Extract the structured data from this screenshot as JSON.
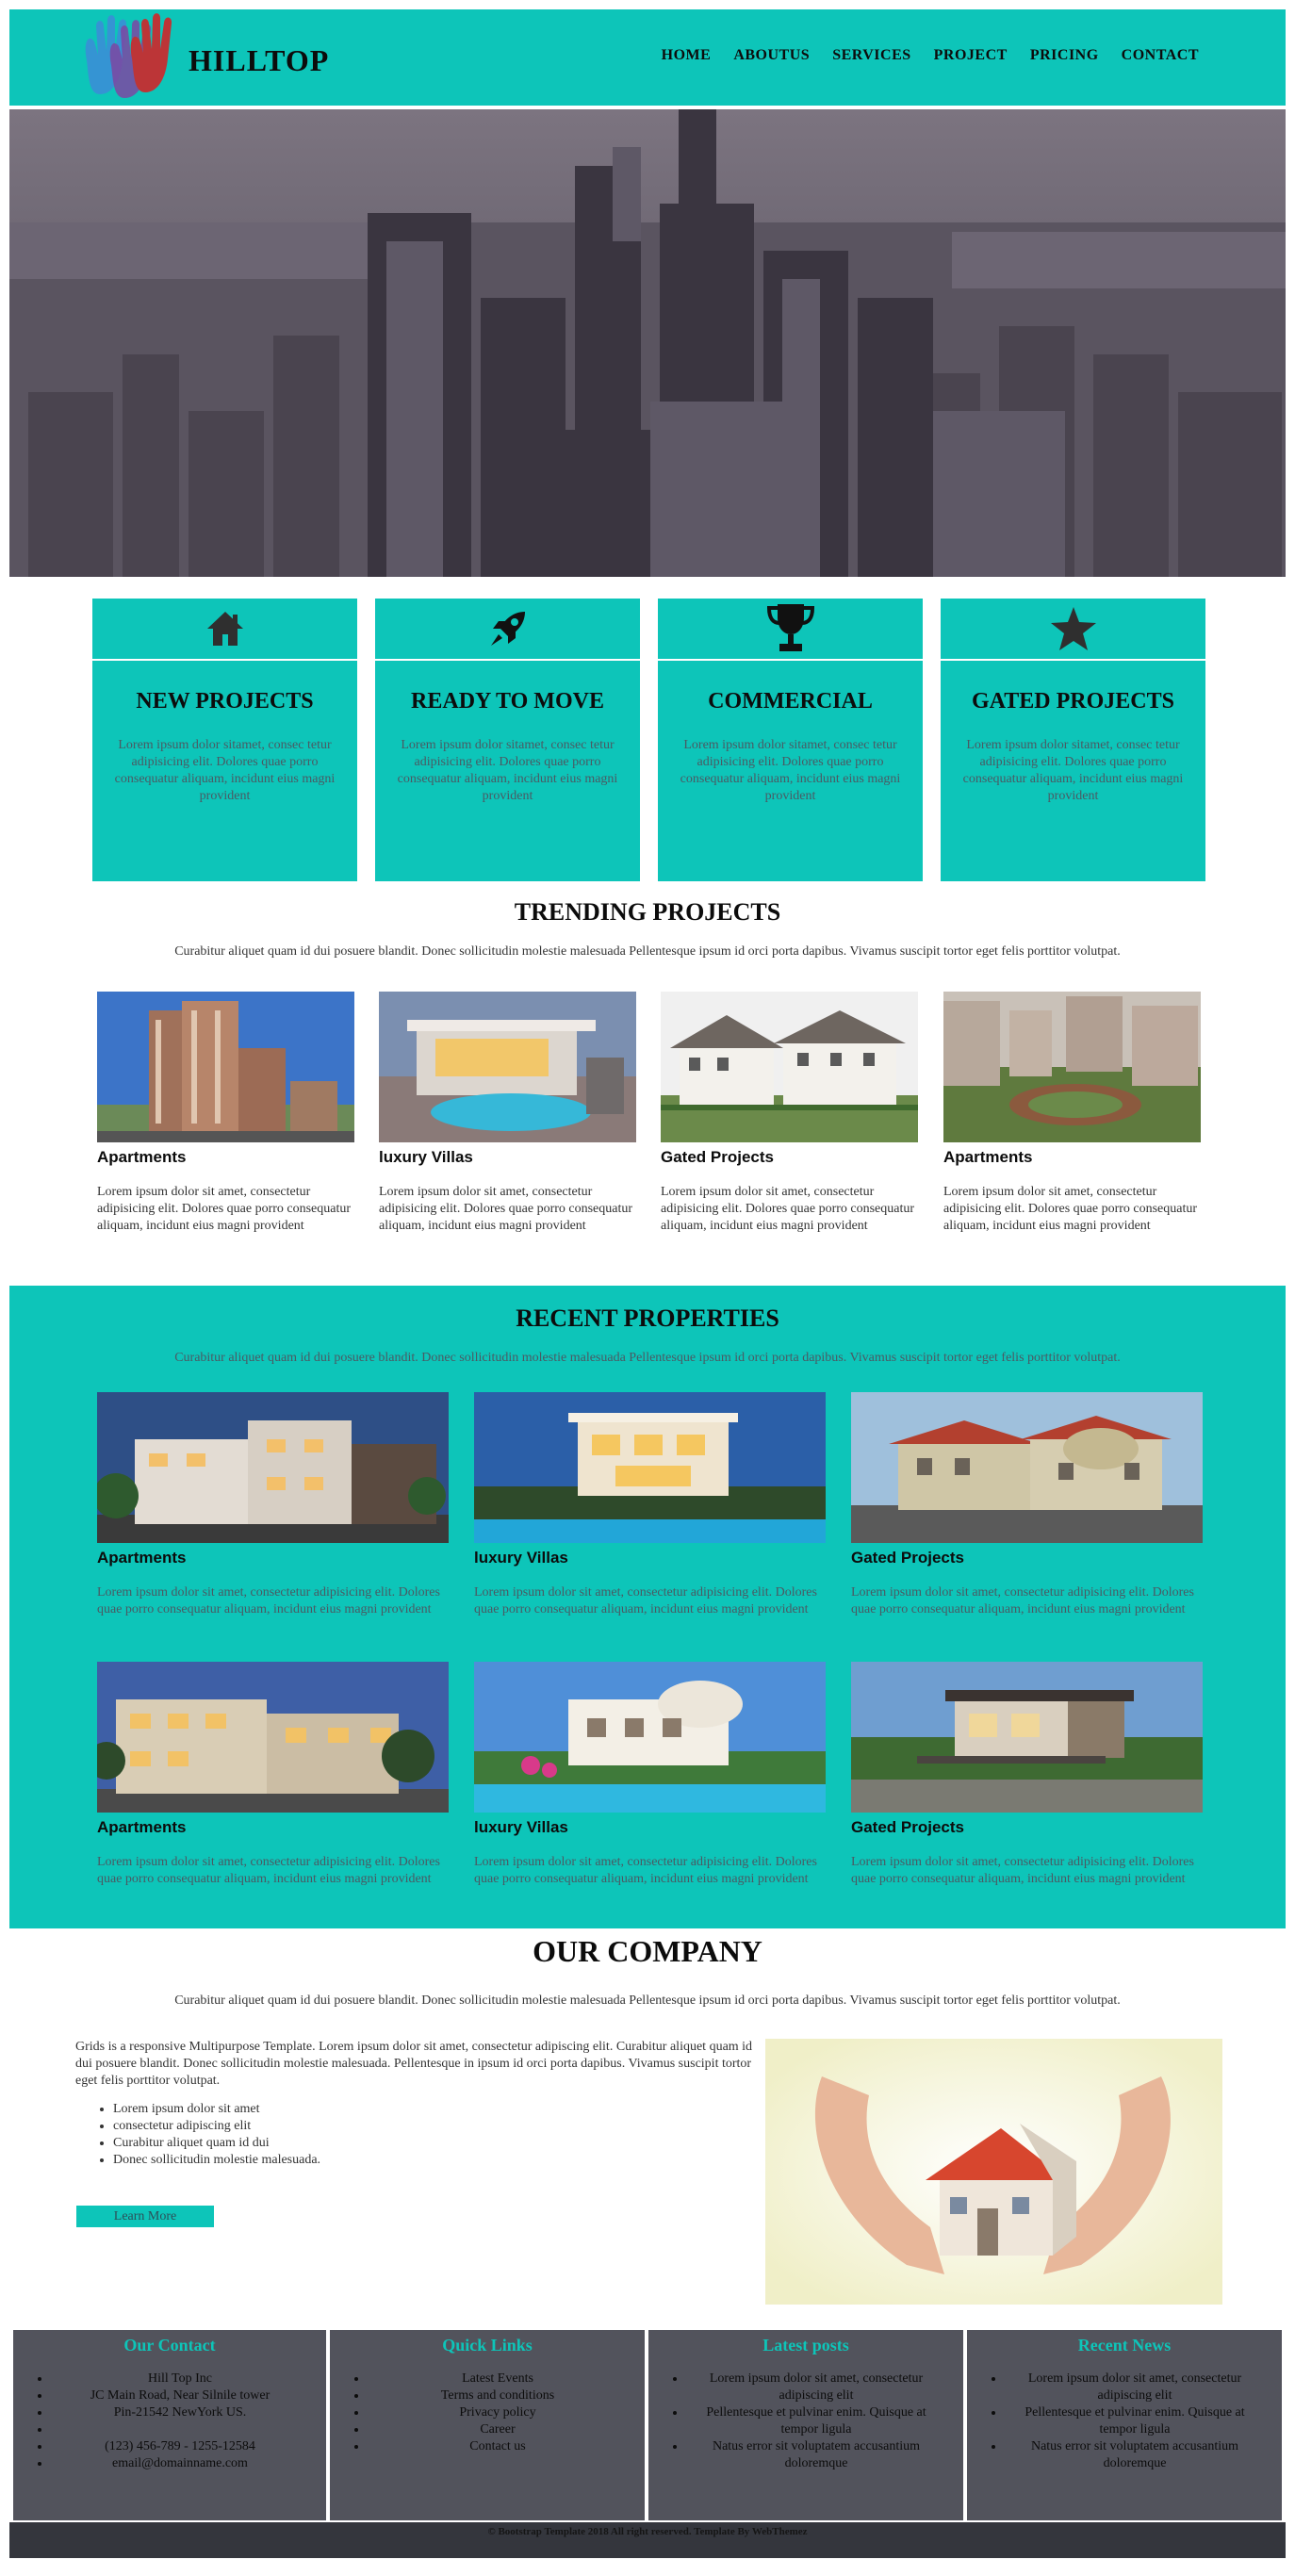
{
  "header": {
    "brand": "HILLTOP",
    "nav": [
      "HOME",
      "ABOUTUS",
      "SERVICES",
      "PROJECT",
      "PRICING",
      "CONTACT"
    ]
  },
  "features": [
    {
      "icon": "home-icon",
      "title": "NEW PROJECTS",
      "text": "Lorem ipsum dolor sitamet, consec tetur adipisicing elit. Dolores quae porro consequatur aliquam, incidunt eius magni provident"
    },
    {
      "icon": "rocket-icon",
      "title": "READY TO MOVE",
      "text": "Lorem ipsum dolor sitamet, consec tetur adipisicing elit. Dolores quae porro consequatur aliquam, incidunt eius magni provident"
    },
    {
      "icon": "trophy-icon",
      "title": "COMMERCIAL",
      "text": "Lorem ipsum dolor sitamet, consec tetur adipisicing elit. Dolores quae porro consequatur aliquam, incidunt eius magni provident"
    },
    {
      "icon": "star-icon",
      "title": "GATED PROJECTS",
      "text": "Lorem ipsum dolor sitamet, consec tetur adipisicing elit. Dolores quae porro consequatur aliquam, incidunt eius magni provident"
    }
  ],
  "trending": {
    "title": "TRENDING PROJECTS",
    "subtitle": "Curabitur aliquet quam id dui posuere blandit. Donec sollicitudin molestie malesuada Pellentesque ipsum id orci porta dapibus. Vivamus suscipit tortor eget felis porttitor volutpat.",
    "items": [
      {
        "title": "Apartments",
        "text": "Lorem ipsum dolor sit amet, consectetur adipisicing elit. Dolores quae porro consequatur aliquam, incidunt eius magni provident"
      },
      {
        "title": "luxury Villas",
        "text": "Lorem ipsum dolor sit amet, consectetur adipisicing elit. Dolores quae porro consequatur aliquam, incidunt eius magni provident"
      },
      {
        "title": "Gated Projects",
        "text": "Lorem ipsum dolor sit amet, consectetur adipisicing elit. Dolores quae porro consequatur aliquam, incidunt eius magni provident"
      },
      {
        "title": "Apartments",
        "text": "Lorem ipsum dolor sit amet, consectetur adipisicing elit. Dolores quae porro consequatur aliquam, incidunt eius magni provident"
      }
    ]
  },
  "recent": {
    "title": "RECENT PROPERTIES",
    "subtitle": "Curabitur aliquet quam id dui posuere blandit. Donec sollicitudin molestie malesuada Pellentesque ipsum id orci porta dapibus. Vivamus suscipit tortor eget felis porttitor volutpat.",
    "items": [
      {
        "title": "Apartments",
        "text": "Lorem ipsum dolor sit amet, consectetur adipisicing elit. Dolores quae porro consequatur aliquam, incidunt eius magni provident"
      },
      {
        "title": "luxury Villas",
        "text": "Lorem ipsum dolor sit amet, consectetur adipisicing elit. Dolores quae porro consequatur aliquam, incidunt eius magni provident"
      },
      {
        "title": "Gated Projects",
        "text": "Lorem ipsum dolor sit amet, consectetur adipisicing elit. Dolores quae porro consequatur aliquam, incidunt eius magni provident"
      },
      {
        "title": "Apartments",
        "text": "Lorem ipsum dolor sit amet, consectetur adipisicing elit. Dolores quae porro consequatur aliquam, incidunt eius magni provident"
      },
      {
        "title": "luxury Villas",
        "text": "Lorem ipsum dolor sit amet, consectetur adipisicing elit. Dolores quae porro consequatur aliquam, incidunt eius magni provident"
      },
      {
        "title": "Gated Projects",
        "text": "Lorem ipsum dolor sit amet, consectetur adipisicing elit. Dolores quae porro consequatur aliquam, incidunt eius magni provident"
      }
    ]
  },
  "company": {
    "title": "OUR COMPANY",
    "subtitle": "Curabitur aliquet quam id dui posuere blandit. Donec sollicitudin molestie malesuada Pellentesque ipsum id orci porta dapibus. Vivamus suscipit tortor eget felis porttitor volutpat.",
    "paragraph": "Grids is a responsive Multipurpose Template. Lorem ipsum dolor sit amet, consectetur adipiscing elit. Curabitur aliquet quam id dui posuere blandit. Donec sollicitudin molestie malesuada. Pellentesque in ipsum id orci porta dapibus. Vivamus suscipit tortor eget felis porttitor volutpat.",
    "bullets": [
      "Lorem ipsum dolor sit amet",
      "consectetur adipiscing elit",
      "Curabitur aliquet quam id dui",
      "Donec sollicitudin molestie malesuada."
    ],
    "button": "Learn More"
  },
  "footer": {
    "columns": [
      {
        "title": "Our Contact",
        "items": [
          "Hill Top Inc",
          "JC Main Road, Near Silnile tower",
          "Pin-21542 NewYork US.",
          "",
          "(123) 456-789 - 1255-12584",
          "email@domainname.com"
        ]
      },
      {
        "title": "Quick Links",
        "items": [
          "Latest Events",
          "Terms and conditions",
          "Privacy policy",
          "Career",
          "Contact us"
        ]
      },
      {
        "title": "Latest posts",
        "items": [
          "Lorem ipsum dolor sit amet, consectetur adipiscing elit",
          "Pellentesque et pulvinar enim. Quisque at tempor ligula",
          "Natus error sit voluptatem accusantium doloremque"
        ]
      },
      {
        "title": "Recent News",
        "items": [
          "Lorem ipsum dolor sit amet, consectetur adipiscing elit",
          "Pellentesque et pulvinar enim. Quisque at tempor ligula",
          "Natus error sit voluptatem accusantium doloremque"
        ]
      }
    ],
    "copyright": "© Bootstrap Template 2018 All right reserved. Template By WebThemez"
  },
  "colors": {
    "accent": "#0dc5b9",
    "footer_bg": "#52535c",
    "copyright_bg": "#34363d"
  }
}
